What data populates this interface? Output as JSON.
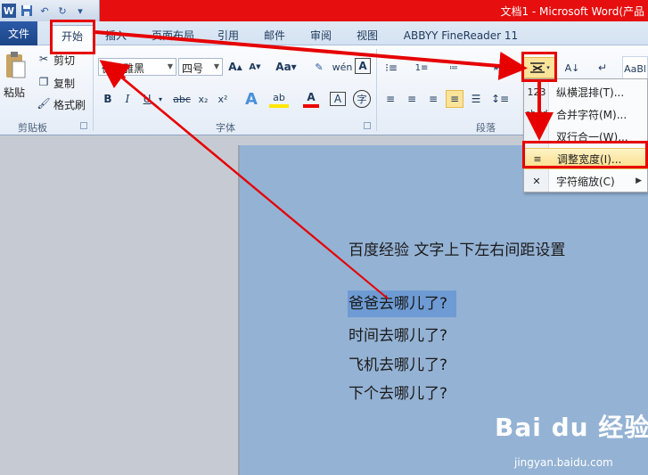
{
  "window": {
    "title": "文档1 - Microsoft Word(产品"
  },
  "tabs": {
    "file": "文件",
    "home": "开始",
    "insert": "插入",
    "layout": "页面布局",
    "references": "引用",
    "mailings": "邮件",
    "review": "审阅",
    "view": "视图",
    "abbyy": "ABBYY FineReader 11"
  },
  "clipboard": {
    "paste": "粘贴",
    "cut": "剪切",
    "copy": "复制",
    "format_painter": "格式刷",
    "group": "剪贴板"
  },
  "font": {
    "name": "微软雅黑",
    "size": "四号",
    "group": "字体"
  },
  "paragraph": {
    "group": "段落"
  },
  "styles": {
    "sample": "AaBl"
  },
  "menu": {
    "items": [
      {
        "icon": "123",
        "label": "纵横混排(T)..."
      },
      {
        "icon": "ab cd",
        "label": "合并字符(M)..."
      },
      {
        "icon": "",
        "label": "双行合一(W)..."
      },
      {
        "icon": "≡",
        "label": "调整宽度(I)..."
      },
      {
        "icon": "✕",
        "label": "字符缩放(C)"
      }
    ]
  },
  "document": {
    "heading": "百度经验 文字上下左右间距设置",
    "lines": [
      "爸爸去哪儿了?",
      "时间去哪儿了?",
      "飞机去哪儿了?",
      "下个去哪儿了?"
    ]
  },
  "watermark": {
    "brand": "Bai du 经验",
    "url": "jingyan.baidu.com"
  },
  "colors": {
    "annotation": "#e60000",
    "title_bar": "#e60e0e",
    "selection": "#6e9bd3",
    "page": "#94b2d4"
  }
}
